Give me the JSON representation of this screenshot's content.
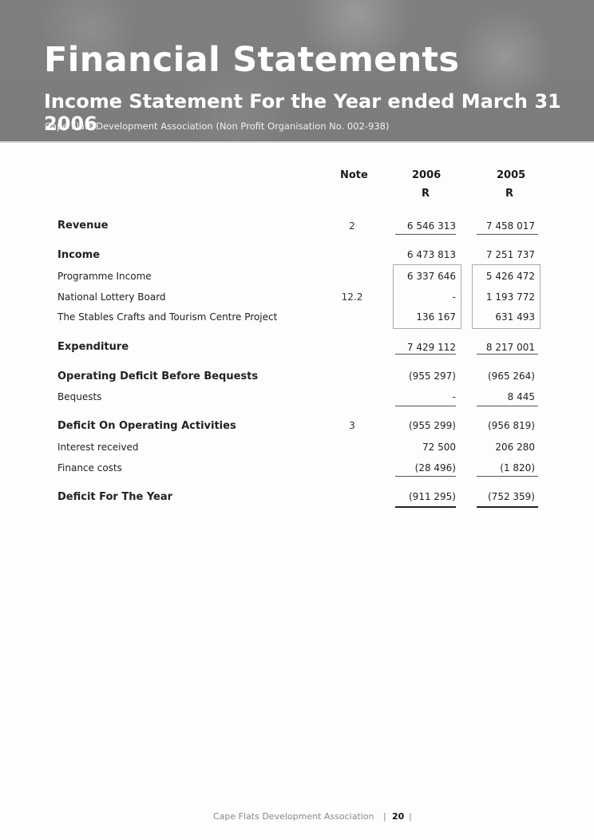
{
  "header": {
    "title": "Financial Statements",
    "subtitle": "Income Statement For the Year ended March 31 2006",
    "organisation": "Cape Flats Development Association (Non Profit Organisation No. 002-938)"
  },
  "columns": {
    "note": "Note",
    "year1": "2006",
    "year2": "2005",
    "currency1": "R",
    "currency2": "R"
  },
  "rows": [
    {
      "label": "Revenue",
      "note": "2",
      "v2006": "6 546 313",
      "v2005": "7 458 017"
    },
    {
      "label": "Income",
      "note": "",
      "v2006": "6 473 813",
      "v2005": "7 251 737"
    },
    {
      "label": "Programme Income",
      "note": "",
      "v2006": "6 337 646",
      "v2005": "5 426 472"
    },
    {
      "label": "National Lottery Board",
      "note": "12.2",
      "v2006": "-",
      "v2005": "1 193 772"
    },
    {
      "label": "The Stables Crafts and Tourism Centre Project",
      "note": "",
      "v2006": "136 167",
      "v2005": "631 493"
    },
    {
      "label": "Expenditure",
      "note": "",
      "v2006": "7 429 112",
      "v2005": "8 217 001"
    },
    {
      "label": "Operating Deficit Before Bequests",
      "note": "",
      "v2006": "(955 297)",
      "v2005": "(965 264)"
    },
    {
      "label": "Bequests",
      "note": "",
      "v2006": "-",
      "v2005": "8 445"
    },
    {
      "label": "Deficit On Operating Activities",
      "note": "3",
      "v2006": "(955 299)",
      "v2005": "(956 819)"
    },
    {
      "label": "Interest received",
      "note": "",
      "v2006": "72 500",
      "v2005": "206 280"
    },
    {
      "label": "Finance costs",
      "note": "",
      "v2006": "(28 496)",
      "v2005": "(1 820)"
    },
    {
      "label": "Deficit For The Year",
      "note": "",
      "v2006": "(911 295)",
      "v2005": "(752 359)"
    }
  ],
  "footer": {
    "organisation": "Cape Flats Development Association",
    "page_number": "20",
    "separator": "|"
  }
}
